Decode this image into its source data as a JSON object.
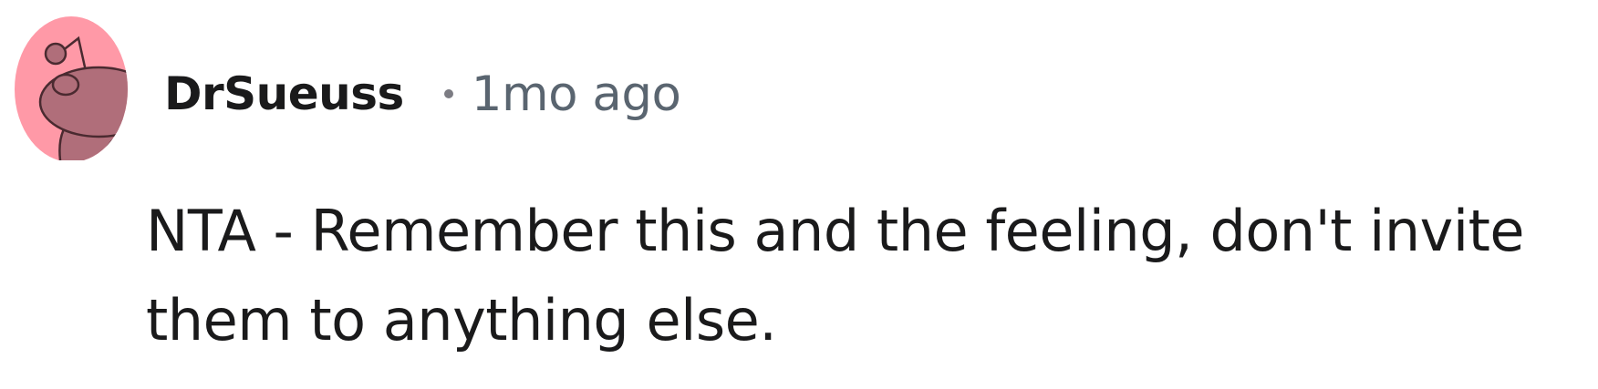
{
  "comment": {
    "avatar_icon": "reddit-snoo-avatar-icon",
    "avatar_colors": {
      "background": "#ff99a7",
      "figure": "#b06e7a",
      "outline": "#4a2a30"
    },
    "username": "DrSueuss",
    "timestamp": "1mo ago",
    "body": "NTA - Remember this and the feeling, don't invite them to anything else."
  }
}
